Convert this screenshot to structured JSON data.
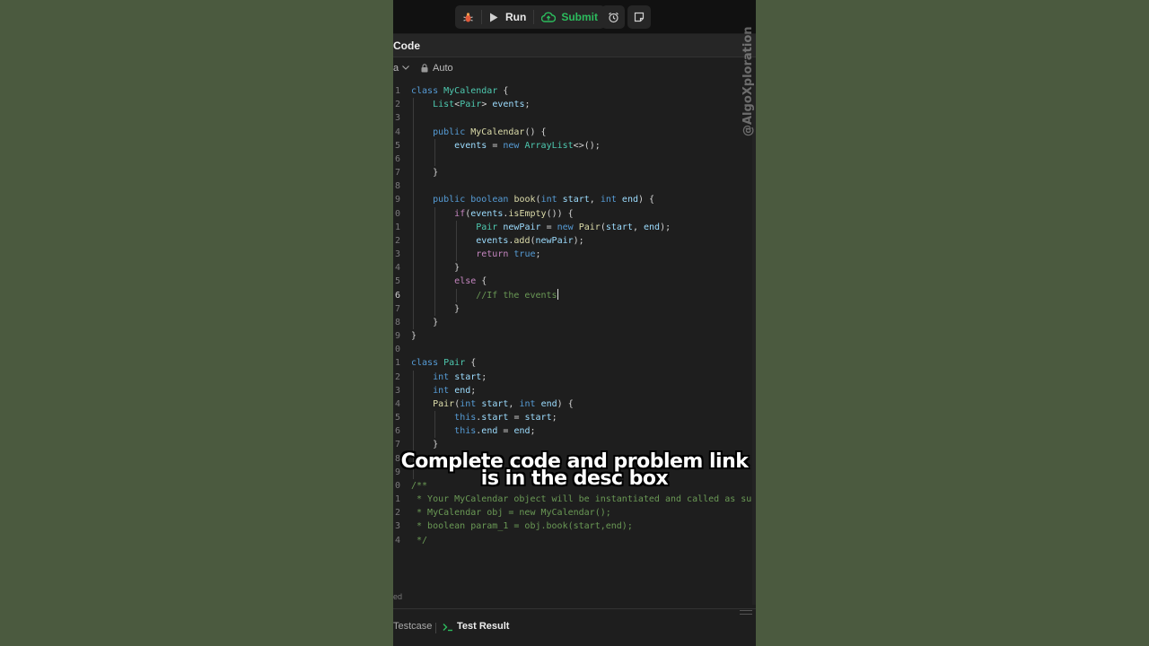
{
  "toolbar": {
    "run_label": "Run",
    "submit_label": "Submit",
    "colors": {
      "submit": "#2cbb5d",
      "bg": "#262626"
    }
  },
  "panel": {
    "title": "Code"
  },
  "editor": {
    "language_fragment": "a",
    "mode_label": "Auto",
    "active_line": 16,
    "lines": [
      {
        "n": "1",
        "text": "class MyCalendar {"
      },
      {
        "n": "2",
        "text": "    List<Pair> events;"
      },
      {
        "n": "3",
        "text": ""
      },
      {
        "n": "4",
        "text": "    public MyCalendar() {"
      },
      {
        "n": "5",
        "text": "        events = new ArrayList<>();"
      },
      {
        "n": "6",
        "text": ""
      },
      {
        "n": "7",
        "text": "    }"
      },
      {
        "n": "8",
        "text": ""
      },
      {
        "n": "9",
        "text": "    public boolean book(int start, int end) {"
      },
      {
        "n": "0",
        "text": "        if(events.isEmpty()) {"
      },
      {
        "n": "1",
        "text": "            Pair newPair = new Pair(start, end);"
      },
      {
        "n": "2",
        "text": "            events.add(newPair);"
      },
      {
        "n": "3",
        "text": "            return true;"
      },
      {
        "n": "4",
        "text": "        }"
      },
      {
        "n": "5",
        "text": "        else {"
      },
      {
        "n": "6",
        "text": "            //If the events"
      },
      {
        "n": "7",
        "text": "        }"
      },
      {
        "n": "8",
        "text": "    }"
      },
      {
        "n": "9",
        "text": "}"
      },
      {
        "n": "0",
        "text": ""
      },
      {
        "n": "1",
        "text": "class Pair {"
      },
      {
        "n": "2",
        "text": "    int start;"
      },
      {
        "n": "3",
        "text": "    int end;"
      },
      {
        "n": "4",
        "text": "    Pair(int start, int end) {"
      },
      {
        "n": "5",
        "text": "        this.start = start;"
      },
      {
        "n": "6",
        "text": "        this.end = end;"
      },
      {
        "n": "7",
        "text": "    }"
      },
      {
        "n": "8",
        "text": ""
      },
      {
        "n": "9",
        "text": ""
      },
      {
        "n": "0",
        "text": "/**"
      },
      {
        "n": "1",
        "text": " * Your MyCalendar object will be instantiated and called as such:"
      },
      {
        "n": "2",
        "text": " * MyCalendar obj = new MyCalendar();"
      },
      {
        "n": "3",
        "text": " * boolean param_1 = obj.book(start,end);"
      },
      {
        "n": "4",
        "text": " */"
      }
    ]
  },
  "overlay": {
    "line1": "Complete code and problem link",
    "line2": "is in the desc box"
  },
  "watermark": "@AlgoXploration",
  "status": {
    "text": "ed"
  },
  "bottom_tabs": {
    "testcase": "Testcase",
    "test_result": "Test Result"
  }
}
